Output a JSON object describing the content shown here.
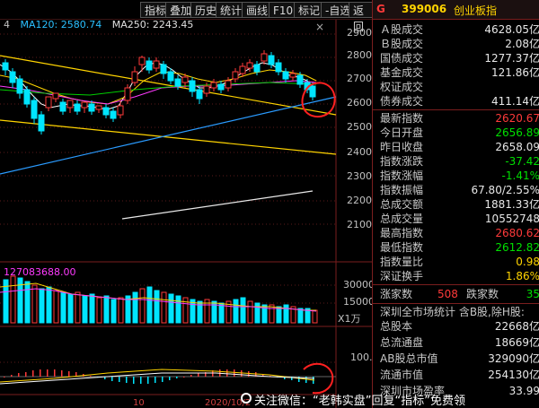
{
  "toolbar": {
    "buttons": [
      "指标",
      "叠加",
      "历史",
      "统计",
      "画线",
      "F10",
      "标记",
      "-自选",
      "返回"
    ],
    "close": "×"
  },
  "ma_legend": {
    "prefix": "4",
    "ma120": "MA120: 2580.74",
    "ma250": "MA250: 2243.45"
  },
  "price_axis": [
    "2900",
    "2800",
    "2700",
    "2600",
    "2500",
    "2400",
    "2300",
    "2200",
    "2100"
  ],
  "volume_axis": [
    "30000",
    "15000"
  ],
  "volume_unit": "X1万",
  "indicator_axis": [
    "100.0"
  ],
  "volume_title": "127083688.00",
  "date_labels": [
    "10",
    "2020/10/2"
  ],
  "panel": {
    "marker": "G",
    "code": "399006",
    "name": "创业板指",
    "rows1": [
      {
        "label": "Ａ股成交",
        "value": "4628.05亿"
      },
      {
        "label": "Ｂ股成交",
        "value": "2.08亿"
      },
      {
        "label": "国债成交",
        "value": "1277.37亿"
      },
      {
        "label": "基金成交",
        "value": "121.86亿"
      },
      {
        "label": "权证成交",
        "value": ""
      },
      {
        "label": "债券成交",
        "value": "411.14亿"
      }
    ],
    "rows2": [
      {
        "label": "最新指数",
        "value": "2620.67"
      },
      {
        "label": "今日开盘",
        "value": "2656.89"
      },
      {
        "label": "昨日收盘",
        "value": "2658.09"
      },
      {
        "label": "指数涨跌",
        "value": "-37.42"
      },
      {
        "label": "指数涨幅",
        "value": "-1.41%"
      },
      {
        "label": "指数振幅",
        "value": "67.80/2.55%"
      },
      {
        "label": "总成交额",
        "value": "1881.33亿"
      },
      {
        "label": "总成交量",
        "value": "10552748"
      },
      {
        "label": "最高指数",
        "value": "2680.62"
      },
      {
        "label": "最低指数",
        "value": "2612.82"
      },
      {
        "label": "指数量比",
        "value": "0.98"
      },
      {
        "label": "深证换手",
        "value": "1.86%"
      }
    ],
    "ups_label": "涨家数",
    "ups_value": "508",
    "downs_label": "跌家数",
    "downs_value": "35",
    "market_stat": "深圳全市场统计 含B股,除H股:",
    "rows3": [
      {
        "label": "总股本",
        "value": "22668亿"
      },
      {
        "label": "总流通盘",
        "value": "18669亿"
      },
      {
        "label": "AB股总市值",
        "value": "329090亿"
      },
      {
        "label": "流通市值",
        "value": "254130亿"
      },
      {
        "label": "深圳市场盈率",
        "value": "33.99"
      }
    ]
  },
  "watermark": "关注微信：“老韩实盘”回复“指标”免费领",
  "colors": {
    "up": "#ff3a3a",
    "down": "#00e5ff",
    "accent_red": "#ff2020",
    "yellow": "#ffd400",
    "panel_border": "#7a1e1e"
  },
  "icons": [
    "close-icon",
    "annotation-circle-icon",
    "wechat-logo-icon"
  ]
}
